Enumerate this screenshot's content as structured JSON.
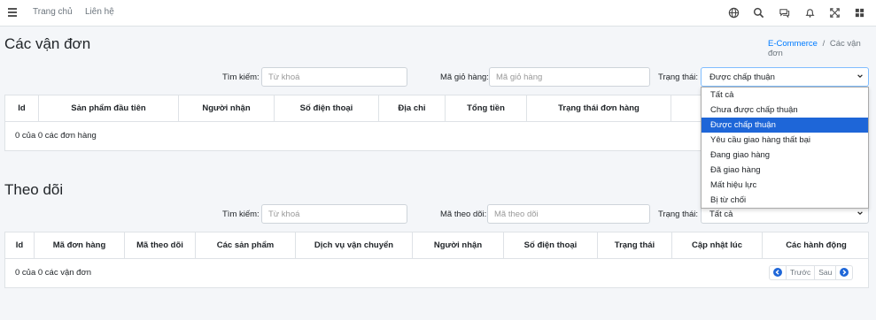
{
  "topbar": {
    "nav": [
      "Trang chủ",
      "Liên hệ"
    ],
    "icons": [
      "globe-icon",
      "search-icon",
      "chat-icon",
      "bell-icon",
      "expand-icon",
      "apps-icon"
    ]
  },
  "orders": {
    "title": "Các vận đơn",
    "breadcrumb": {
      "home": "E-Commerce",
      "separator": "/",
      "current": "Các vận đơn"
    },
    "filters": {
      "search_label": "Tìm kiếm:",
      "search_placeholder": "Từ khoá",
      "cart_label": "Mã giỏ hàng:",
      "cart_placeholder": "Mã giỏ hàng",
      "status_label": "Trạng thái:",
      "status_value": "Được chấp thuận"
    },
    "columns": [
      "Id",
      "Sản phẩm đầu tiên",
      "Người nhận",
      "Số điện thoại",
      "Địa chỉ",
      "Tổng tiền",
      "Trạng thái đơn hàng",
      "T"
    ],
    "empty_text": "0 của 0 các đơn hàng"
  },
  "status_dropdown": {
    "options": [
      "Tất cả",
      "Chưa được chấp thuận",
      "Được chấp thuận",
      "Yêu cầu giao hàng thất bại",
      "Đang giao hàng",
      "Đã giao hàng",
      "Mất hiệu lực",
      "Bị từ chối"
    ],
    "selected_index": 2
  },
  "tracking": {
    "title": "Theo dõi",
    "filters": {
      "search_label": "Tìm kiếm:",
      "search_placeholder": "Từ khoá",
      "tracking_label": "Mã theo dõi:",
      "tracking_placeholder": "Mã theo dõi",
      "status_label": "Trạng thái:",
      "status_value": "Tất cả"
    },
    "columns": [
      "Id",
      "Mã đơn hàng",
      "Mã theo dõi",
      "Các sản phẩm",
      "Dịch vụ vận chuyển",
      "Người nhận",
      "Số điện thoại",
      "Trạng thái",
      "Cập nhật lúc",
      "Các hành động"
    ],
    "empty_text": "0 của 0 các vận đơn",
    "pager": {
      "prev": "Trước",
      "next": "Sau"
    }
  },
  "colors": {
    "accent": "#1e66d8",
    "link": "#007bff",
    "background": "#f4f6f9"
  }
}
